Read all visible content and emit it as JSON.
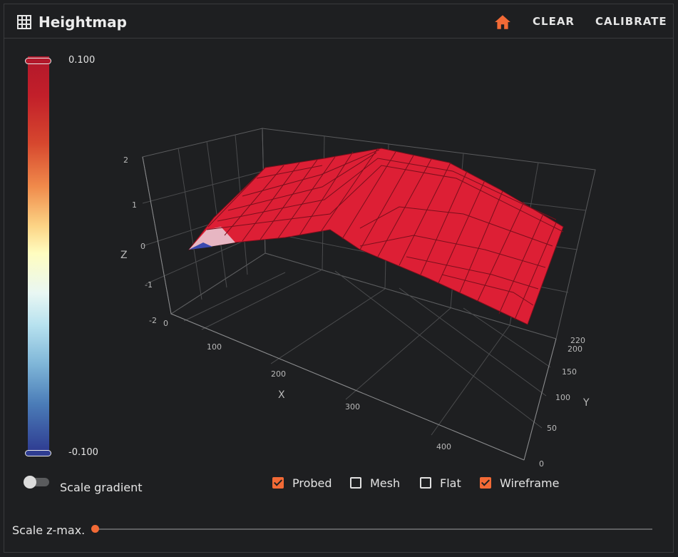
{
  "header": {
    "title": "Heightmap",
    "clear_label": "CLEAR",
    "calibrate_label": "CALIBRATE"
  },
  "colors": {
    "accent": "#f26a36",
    "background": "#1e1f21",
    "surface": "#dd1f35"
  },
  "colorbar": {
    "max_label": "0.100",
    "min_label": "-0.100"
  },
  "plot": {
    "axes": {
      "x_title": "X",
      "y_title": "Y",
      "z_title": "Z",
      "x_ticks": [
        "0",
        "100",
        "200",
        "300",
        "400"
      ],
      "y_ticks": [
        "0",
        "50",
        "100",
        "150",
        "200",
        "220"
      ],
      "z_ticks": [
        "2",
        "1",
        "0",
        "-1",
        "-2"
      ]
    }
  },
  "controls": {
    "scale_gradient_label": "Scale gradient",
    "scale_gradient_on": false,
    "options": [
      {
        "label": "Probed",
        "checked": true
      },
      {
        "label": "Mesh",
        "checked": false
      },
      {
        "label": "Flat",
        "checked": false
      },
      {
        "label": "Wireframe",
        "checked": true
      }
    ],
    "scale_zmax_label": "Scale z-max.",
    "scale_zmax_value": 0
  }
}
